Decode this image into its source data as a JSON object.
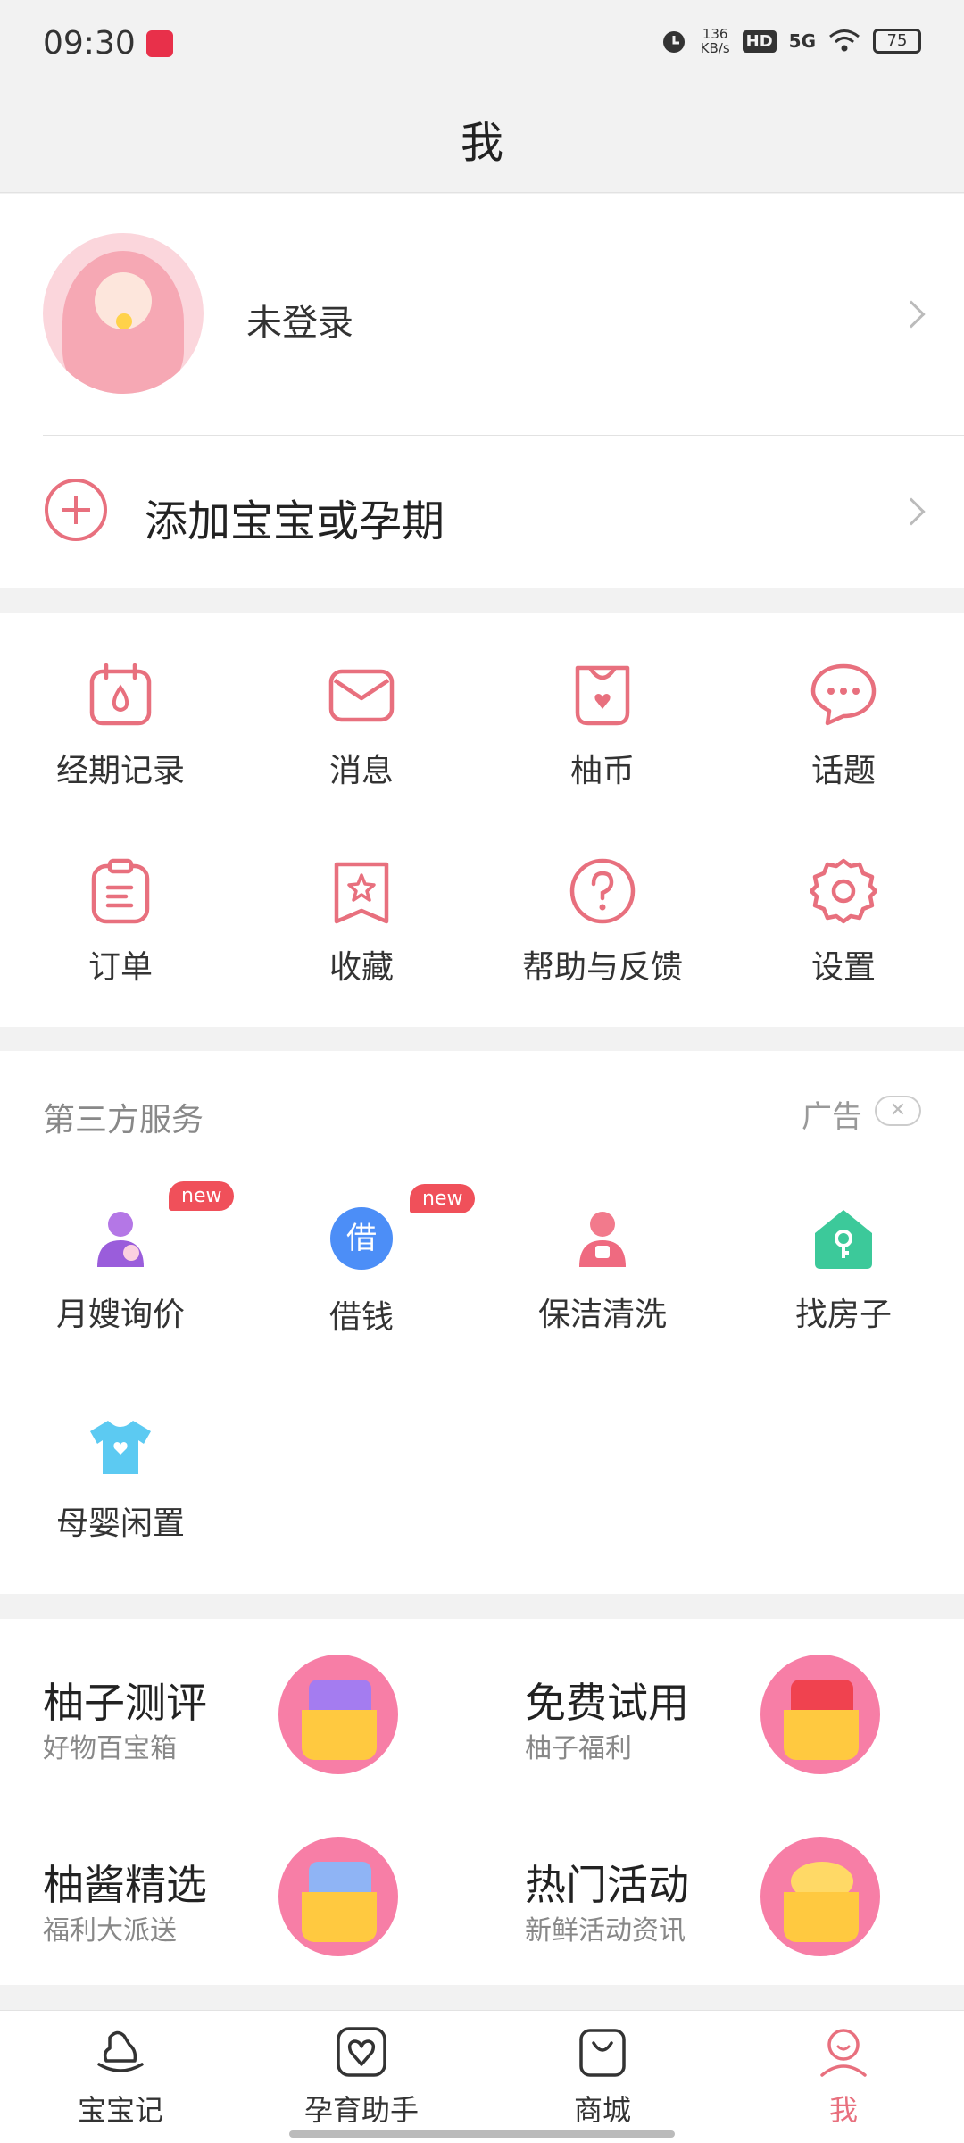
{
  "status": {
    "time": "09:30",
    "speed_value": "136",
    "speed_unit": "KB/s",
    "hd": "HD",
    "net": "5G",
    "battery": "75"
  },
  "header": {
    "title": "我"
  },
  "profile": {
    "login_text": "未登录",
    "add_text": "添加宝宝或孕期"
  },
  "menu": [
    {
      "label": "经期记录",
      "icon": "calendar-drop-icon"
    },
    {
      "label": "消息",
      "icon": "envelope-icon"
    },
    {
      "label": "柚币",
      "icon": "coin-bag-icon"
    },
    {
      "label": "话题",
      "icon": "chat-bubble-icon"
    },
    {
      "label": "订单",
      "icon": "clipboard-icon"
    },
    {
      "label": "收藏",
      "icon": "star-bookmark-icon"
    },
    {
      "label": "帮助与反馈",
      "icon": "question-icon"
    },
    {
      "label": "设置",
      "icon": "gear-icon"
    }
  ],
  "third_party": {
    "title": "第三方服务",
    "ad_label": "广告",
    "close": "✕",
    "items": [
      {
        "label": "月嫂询价",
        "badge": "new",
        "icon": "nanny-icon"
      },
      {
        "label": "借钱",
        "badge": "new",
        "icon_text": "借",
        "icon": "loan-icon"
      },
      {
        "label": "保洁清洗",
        "icon": "cleaner-icon"
      },
      {
        "label": "找房子",
        "icon": "house-key-icon"
      },
      {
        "label": "母婴闲置",
        "icon": "baby-clothes-icon"
      }
    ]
  },
  "promos": [
    {
      "title": "柚子测评",
      "subtitle": "好物百宝箱"
    },
    {
      "title": "免费试用",
      "subtitle": "柚子福利"
    },
    {
      "title": "柚酱精选",
      "subtitle": "福利大派送"
    },
    {
      "title": "热门活动",
      "subtitle": "新鲜活动资讯"
    }
  ],
  "tabs": [
    {
      "label": "宝宝记",
      "icon": "rocking-horse-icon"
    },
    {
      "label": "孕育助手",
      "icon": "heart-leaf-icon"
    },
    {
      "label": "商城",
      "icon": "shopping-bag-icon"
    },
    {
      "label": "我",
      "icon": "person-icon",
      "active": true
    }
  ],
  "colors": {
    "accent": "#e8707e",
    "badge": "#f0505a",
    "background": "#f2f2f2"
  }
}
